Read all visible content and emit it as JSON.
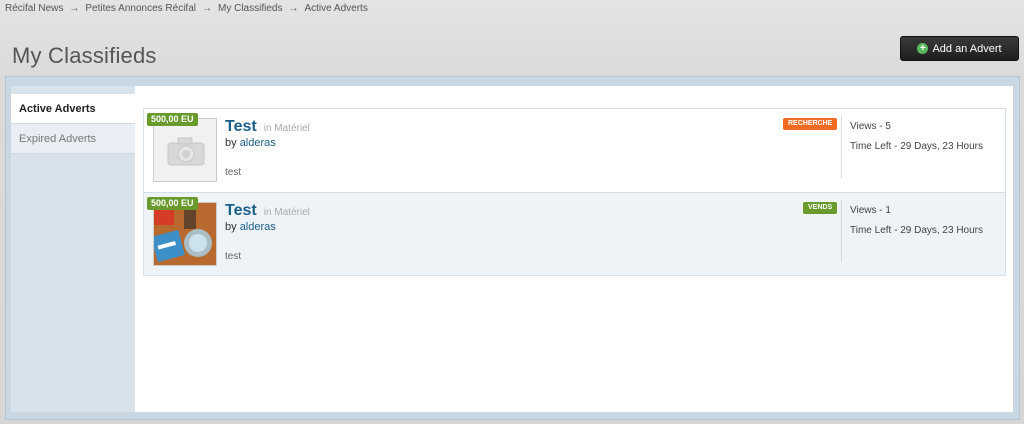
{
  "breadcrumb": {
    "items": [
      "Récifal News",
      "Petites Annonces Récifal",
      "My Classifieds",
      "Active Adverts"
    ],
    "separator": "→"
  },
  "page": {
    "title": "My Classifieds"
  },
  "actions": {
    "add_label": "Add an Advert"
  },
  "sidebar": {
    "tabs": [
      {
        "label": "Active Adverts",
        "active": true
      },
      {
        "label": "Expired Adverts",
        "active": false
      }
    ]
  },
  "adverts": [
    {
      "price": "500,00 EU",
      "title": "Test",
      "category": "in Matériel",
      "by_prefix": "by",
      "author": "alderas",
      "description": "test",
      "badge": "RECHERCHE",
      "views": "Views - 5",
      "time_left": "Time Left - 29 Days, 23 Hours"
    },
    {
      "price": "500,00 EU",
      "title": "Test",
      "category": "in Matériel",
      "by_prefix": "by",
      "author": "alderas",
      "description": "test",
      "badge": "VENDS",
      "views": "Views - 1",
      "time_left": "Time Left - 29 Days, 23 Hours"
    }
  ],
  "colors": {
    "accent": "#1a5e8a",
    "badge_recherche": "#f26b22",
    "badge_vends": "#6a9a2e"
  }
}
